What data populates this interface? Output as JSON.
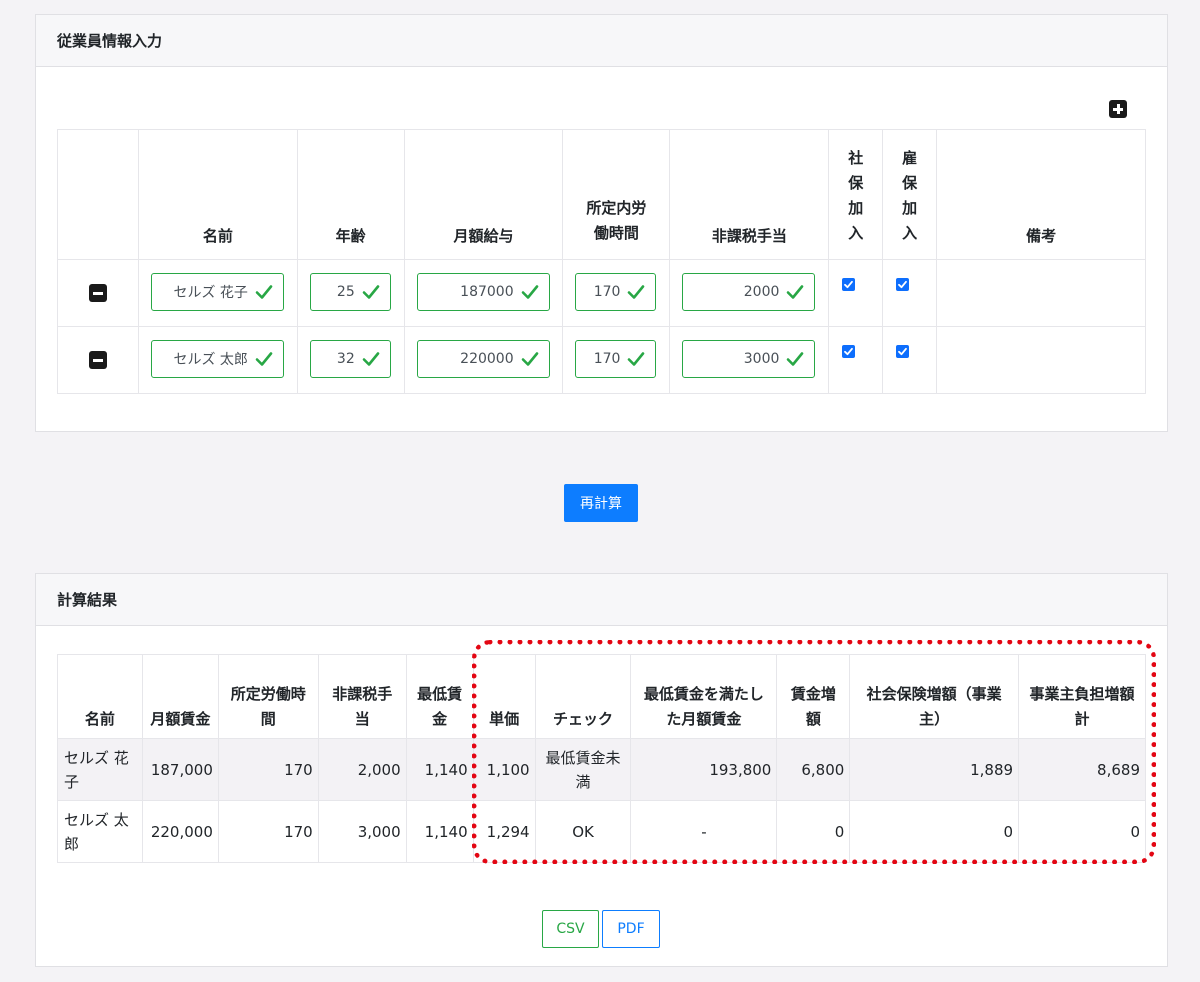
{
  "input_section": {
    "title": "従業員情報入力",
    "columns": [
      "名前",
      "年齢",
      "月額給与",
      "所定内労働時間",
      "非課税手当",
      "社保加入",
      "雇保加入",
      "備考"
    ],
    "rows": [
      {
        "name": "セルズ 花子",
        "age": "25",
        "salary": "187000",
        "hours": "170",
        "allowance": "2000",
        "shaho": true,
        "koho": true,
        "note": ""
      },
      {
        "name": "セルズ 太郎",
        "age": "32",
        "salary": "220000",
        "hours": "170",
        "allowance": "3000",
        "shaho": true,
        "koho": true,
        "note": ""
      }
    ]
  },
  "recalc_button": "再計算",
  "result_section": {
    "title": "計算結果",
    "columns": [
      "名前",
      "月額賃金",
      "所定労働時間",
      "非課税手当",
      "最低賃金",
      "単価",
      "チェック",
      "最低賃金を満たした月額賃金",
      "賃金増額",
      "社会保険増額（事業主）",
      "事業主負担増額計"
    ],
    "rows": [
      {
        "name": "セルズ 花子",
        "wage": "187,000",
        "hours": "170",
        "allowance": "2,000",
        "min_wage": "1,140",
        "unit": "1,100",
        "check": "最低賃金未満",
        "required": "193,800",
        "increase": "6,800",
        "social": "1,889",
        "total": "8,689"
      },
      {
        "name": "セルズ 太郎",
        "wage": "220,000",
        "hours": "170",
        "allowance": "3,000",
        "min_wage": "1,140",
        "unit": "1,294",
        "check": "OK",
        "required": "-",
        "increase": "0",
        "social": "0",
        "total": "0"
      }
    ]
  },
  "export_buttons": {
    "csv": "CSV",
    "pdf": "PDF"
  },
  "colors": {
    "valid": "#28a745",
    "primary": "#0d7dff",
    "highlight": "#e30613",
    "checkbox": "#0d6efd"
  }
}
